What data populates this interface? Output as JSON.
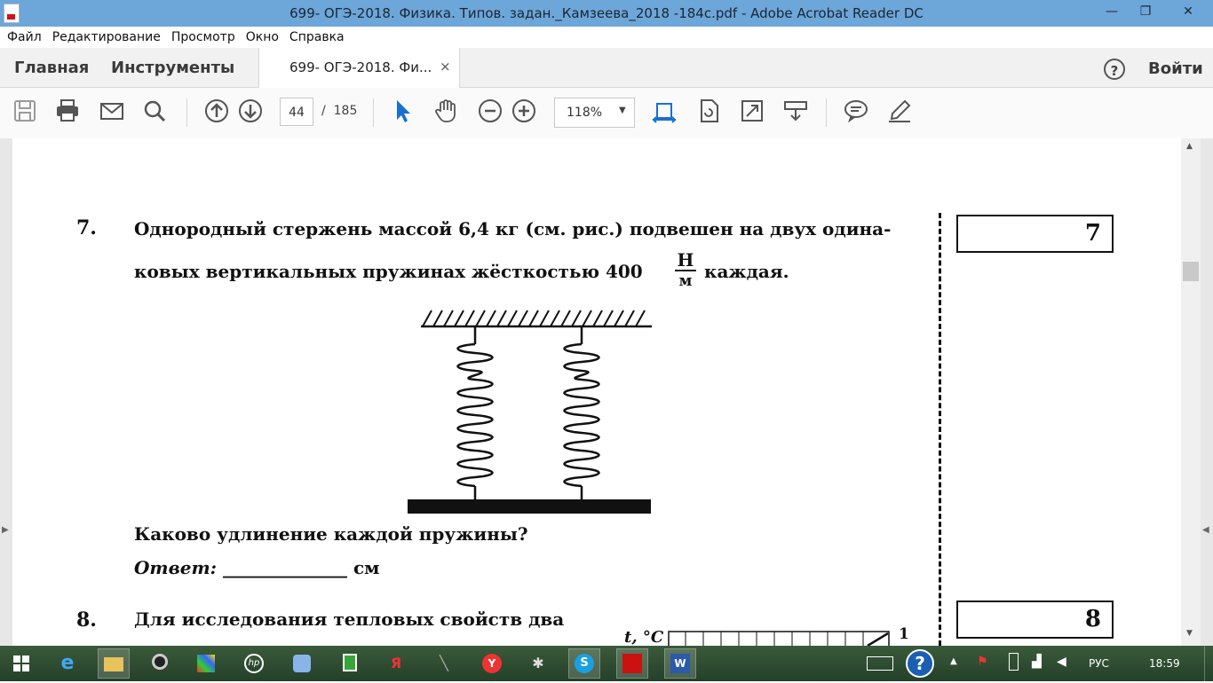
{
  "window": {
    "title": "699- ОГЭ-2018. Физика. Типов. задан._Камзеева_2018 -184с.pdf - Adobe Acrobat Reader DC",
    "minimize": "—",
    "maximize": "❐",
    "close": "✕"
  },
  "menu": [
    "Файл",
    "Редактирование",
    "Просмотр",
    "Окно",
    "Справка"
  ],
  "nav_tabs": {
    "home": "Главная",
    "tools": "Инструменты"
  },
  "doc_tab": {
    "label": "699- ОГЭ-2018. Фи...",
    "close": "×"
  },
  "login": "Войти",
  "help_symbol": "?",
  "toolbar": {
    "page_current": "44",
    "page_separator": "/",
    "page_total": "185",
    "zoom": "118%",
    "zoom_arrow": "▼",
    "icons": [
      "save-icon",
      "print-icon",
      "email-icon",
      "search-icon",
      "page-up-icon",
      "page-down-icon",
      "select-cursor-icon",
      "hand-icon",
      "zoom-out-icon",
      "zoom-in-icon",
      "fit-width-icon",
      "rotate-icon",
      "full-screen-icon",
      "read-mode-icon",
      "comment-icon",
      "highlight-icon"
    ]
  },
  "document": {
    "q7": {
      "number": "7.",
      "line1": "Однородный стержень массой 6,4 кг (см. рис.) подвешен на двух одина-",
      "line2_a": "ковых вертикальных пружинах жёсткостью",
      "value": "400",
      "unit_num": "Н",
      "unit_den": "м",
      "line2_b": "каждая.",
      "question": "Каково удлинение каждой пружины?",
      "answer_label": "Ответ:",
      "answer_blank": "______________",
      "answer_unit": "см",
      "box_number": "7"
    },
    "q8": {
      "number": "8.",
      "line1": "Для  исследования  тепловых  свойств  два",
      "axis_label": "t, °C",
      "axis_tick": "1",
      "box_number": "8"
    }
  },
  "taskbar": {
    "language": "РУС",
    "time": "18:59",
    "apps": [
      "windows-start-icon",
      "ie-icon",
      "explorer-icon",
      "camera-icon",
      "media-icon",
      "hp-icon",
      "audio-icon",
      "calculator-icon",
      "yandex-icon",
      "tool-icon",
      "yandex-browser-icon",
      "badminton-icon",
      "skype-icon",
      "acrobat-icon",
      "word-icon"
    ]
  }
}
